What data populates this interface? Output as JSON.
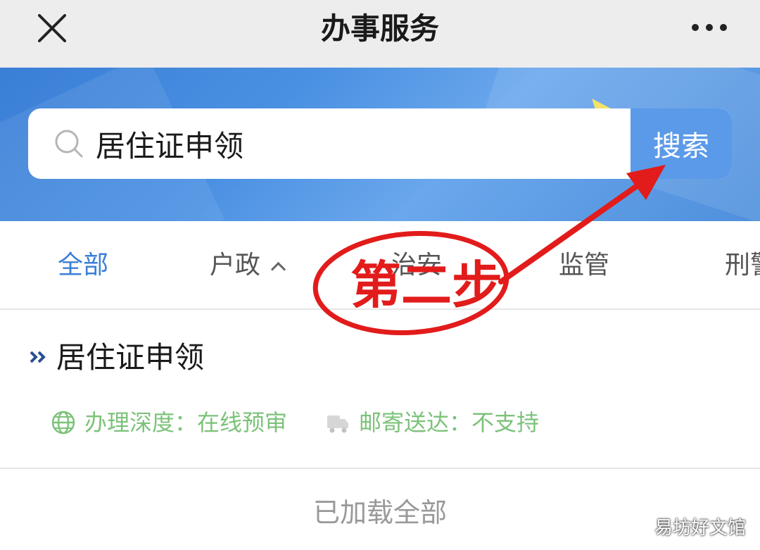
{
  "header": {
    "title": "办事服务",
    "close_icon": "close-icon",
    "more_icon": "more-dots-icon"
  },
  "search": {
    "value": "居住证申领",
    "button_label": "搜索",
    "icon": "search-icon"
  },
  "tabs": [
    {
      "label": "全部",
      "active": true
    },
    {
      "label": "户政",
      "active": false,
      "has_caret": true
    },
    {
      "label": "治安",
      "active": false
    },
    {
      "label": "监管",
      "active": false
    },
    {
      "label": "刑警",
      "active": false
    }
  ],
  "results": [
    {
      "title": "居住证申领",
      "depth_label": "办理深度：",
      "depth_value": "在线预审",
      "mail_label": "邮寄送达：",
      "mail_value": "不支持"
    }
  ],
  "footer": {
    "loaded_text": "已加载全部"
  },
  "annotation": {
    "text": "第二步",
    "color": "#e21b1b"
  },
  "watermark": "易坊好文馆",
  "colors": {
    "accent": "#3a7fd6",
    "search_button": "#5b9ae9",
    "meta_green": "#7cc27a",
    "annotation_red": "#e21b1b"
  }
}
